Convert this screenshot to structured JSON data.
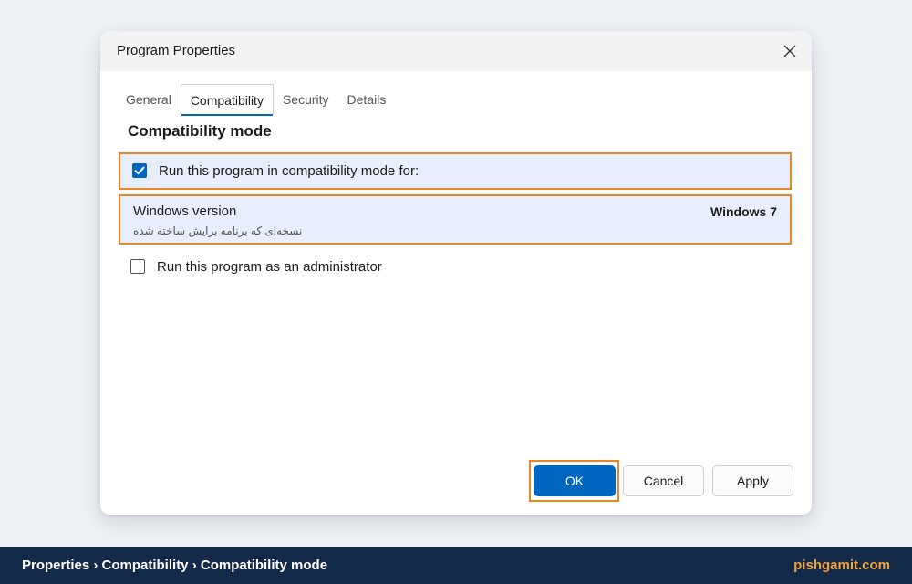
{
  "window": {
    "title": "Program Properties",
    "close_icon": "close-icon"
  },
  "tabs": [
    {
      "label": "General",
      "active": false
    },
    {
      "label": "Compatibility",
      "active": true
    },
    {
      "label": "Security",
      "active": false
    },
    {
      "label": "Details",
      "active": false
    }
  ],
  "compatibility": {
    "heading": "Compatibility mode",
    "run_compat": {
      "label": "Run this program in compatibility mode for:",
      "checked": true
    },
    "windows_version": {
      "label": "Windows version",
      "sublabel": "نسخه‌ای که برنامه برایش ساخته شده",
      "value": "Windows 7"
    },
    "run_admin": {
      "label": "Run this program as an administrator",
      "checked": false
    }
  },
  "buttons": {
    "ok": "OK",
    "cancel": "Cancel",
    "apply": "Apply"
  },
  "footer": {
    "breadcrumb": "Properties › Compatibility › Compatibility mode",
    "brand": "pishgamit.com"
  },
  "colors": {
    "accent": "#0067c0",
    "highlight_border": "#e8862a",
    "highlight_fill": "#e8eefb",
    "footer_bg": "#12294a",
    "brand": "#f0a33a"
  }
}
